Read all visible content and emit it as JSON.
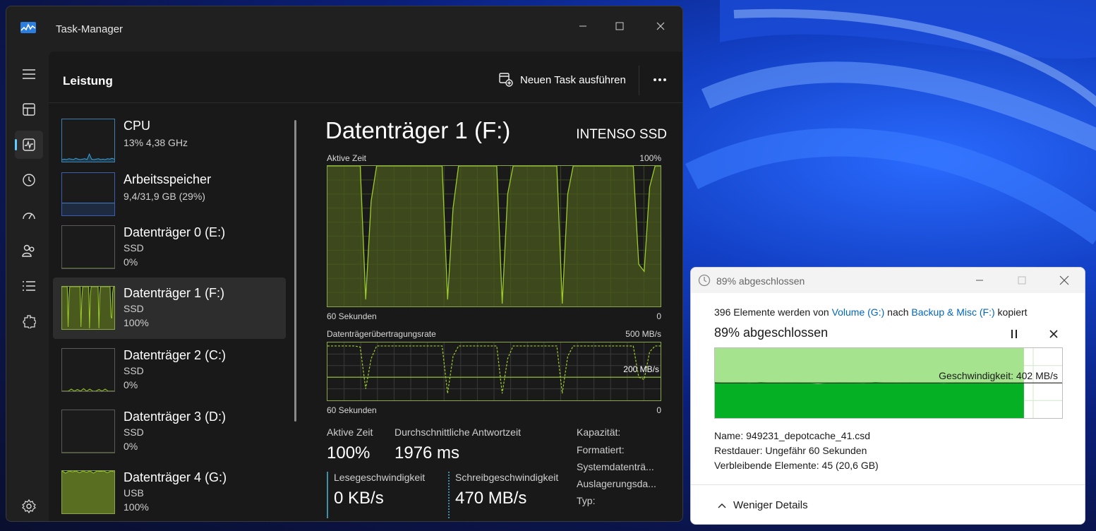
{
  "colors": {
    "accent": "#60cdff",
    "disk_green": "#9ccc2c",
    "copy_green": "#06b025",
    "copy_light_green": "#a6e38f",
    "link_blue": "#0067c0"
  },
  "task_manager": {
    "window_title": "Task-Manager",
    "page_title": "Leistung",
    "run_new_task_label": "Neuen Task ausführen",
    "nav_icons": [
      "hamburger-icon",
      "processes-icon",
      "performance-icon",
      "app-history-icon",
      "startup-icon",
      "users-icon",
      "details-icon",
      "services-icon",
      "settings-icon"
    ],
    "devices": [
      {
        "name": "CPU",
        "sub1": "13%  4,38 GHz",
        "sub2": "",
        "load": 0.13
      },
      {
        "name": "Arbeitsspeicher",
        "sub1": "9,4/31,9 GB (29%)",
        "sub2": "",
        "load": 0.29
      },
      {
        "name": "Datenträger 0 (E:)",
        "sub1": "SSD",
        "sub2": "0%",
        "load": 0
      },
      {
        "name": "Datenträger 1 (F:)",
        "sub1": "SSD",
        "sub2": "100%",
        "load": 1.0
      },
      {
        "name": "Datenträger 2 (C:)",
        "sub1": "SSD",
        "sub2": "0%",
        "load": 0
      },
      {
        "name": "Datenträger 3 (D:)",
        "sub1": "SSD",
        "sub2": "0%",
        "load": 0
      },
      {
        "name": "Datenträger 4 (G:)",
        "sub1": "USB",
        "sub2": "100%",
        "load": 1.0
      }
    ],
    "detail": {
      "title": "Datenträger 1 (F:)",
      "model": "INTENSO SSD",
      "graph1": {
        "label": "Aktive Zeit",
        "max": "100%",
        "x_left": "60 Sekunden",
        "x_right": "0"
      },
      "graph2": {
        "label": "Datenträgerübertragungsrate",
        "max": "500 MB/s",
        "ref": "200 MB/s",
        "x_left": "60 Sekunden",
        "x_right": "0"
      },
      "active_time_label": "Aktive Zeit",
      "active_time_value": "100%",
      "response_label": "Durchschnittliche Antwortzeit",
      "response_value": "1976 ms",
      "read_label": "Lesegeschwindigkeit",
      "read_value": "0 KB/s",
      "write_label": "Schreibgeschwindigkeit",
      "write_value": "470 MB/s",
      "props": [
        "Kapazität:",
        "Formatiert:",
        "Systemdatenträ...",
        "Auslagerungsda...",
        "Typ:"
      ]
    }
  },
  "copy_dialog": {
    "title": "89% abgeschlossen",
    "msg_prefix": "396 Elemente werden von ",
    "source": "Volume (G:)",
    "msg_mid": " nach ",
    "dest": "Backup & Misc (F:)",
    "msg_suffix": " kopiert",
    "progress_text": "89% abgeschlossen",
    "progress": 0.89,
    "speed": "Geschwindigkeit: 402 MB/s",
    "name_line": "Name:  949231_depotcache_41.csd",
    "remaining_time": "Restdauer: Ungefähr 60 Sekunden",
    "remaining_items": "Verbleibende Elemente: 45 (20,6 GB)",
    "less_details": "Weniger Details"
  },
  "series": {
    "active_time": [
      100,
      100,
      100,
      100,
      100,
      100,
      100,
      5,
      75,
      100,
      100,
      100,
      100,
      100,
      100,
      100,
      100,
      100,
      100,
      100,
      100,
      100,
      5,
      70,
      100,
      100,
      100,
      100,
      100,
      100,
      100,
      100,
      2,
      80,
      100,
      100,
      100,
      100,
      100,
      100,
      100,
      100,
      100,
      2,
      80,
      100,
      100,
      100,
      100,
      100,
      100,
      100,
      100,
      100,
      100,
      100,
      100,
      30,
      25,
      85,
      100,
      100
    ],
    "transfer_rate": [
      470,
      470,
      470,
      470,
      470,
      470,
      460,
      100,
      360,
      470,
      470,
      470,
      470,
      470,
      470,
      470,
      470,
      470,
      470,
      470,
      470,
      470,
      60,
      380,
      470,
      470,
      470,
      470,
      470,
      470,
      470,
      470,
      60,
      360,
      470,
      470,
      470,
      470,
      470,
      470,
      470,
      470,
      470,
      60,
      380,
      470,
      470,
      470,
      470,
      470,
      470,
      470,
      470,
      470,
      470,
      470,
      470,
      200,
      180,
      420,
      470,
      470
    ],
    "copy_speed": [
      410,
      400,
      405,
      395,
      410,
      400,
      398,
      405,
      402,
      390,
      402,
      405,
      400,
      395,
      410,
      402,
      398,
      405,
      400,
      402,
      395,
      405,
      400,
      402,
      398,
      403,
      400,
      402
    ]
  }
}
